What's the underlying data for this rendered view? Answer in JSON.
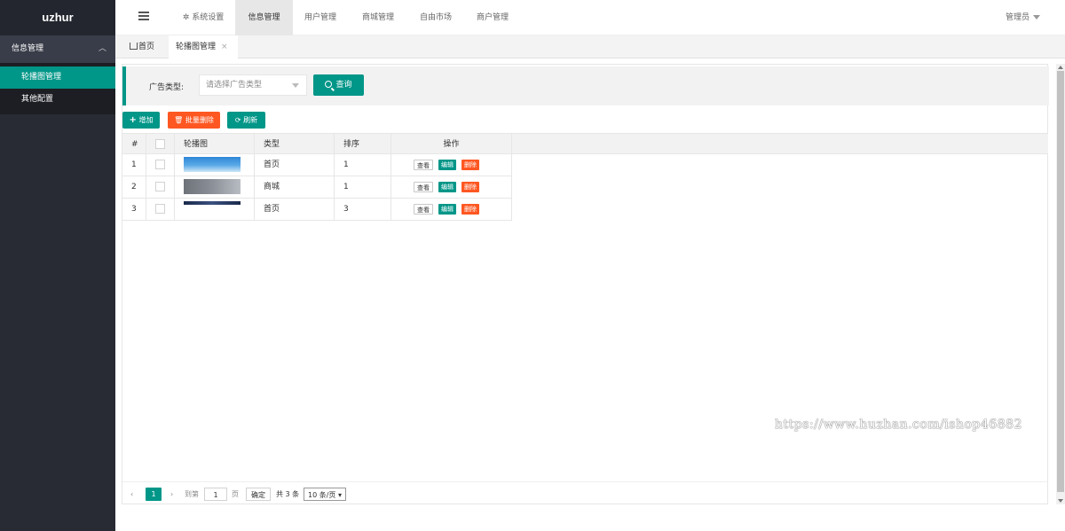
{
  "sidebar": {
    "logo": "uzhur",
    "section": "信息管理",
    "items": [
      "轮播图管理",
      "其他配置"
    ]
  },
  "header": {
    "nav": [
      "系统设置",
      "信息管理",
      "用户管理",
      "商城管理",
      "自由市场",
      "商户管理"
    ],
    "active_nav": "信息管理",
    "user": "管理员"
  },
  "tabs": {
    "home": "首页",
    "current": "轮播图管理",
    "close": "×"
  },
  "search": {
    "label": "广告类型:",
    "placeholder": "请选择广告类型",
    "query_label": "查询"
  },
  "toolbar": {
    "add": "增加",
    "batch_delete": "批量删除",
    "refresh": "刷新"
  },
  "table": {
    "columns": [
      "#",
      "",
      "轮播图",
      "类型",
      "排序",
      "操作"
    ],
    "rows": [
      {
        "idx": "1",
        "type": "首页",
        "sort": "1"
      },
      {
        "idx": "2",
        "type": "商城",
        "sort": "1"
      },
      {
        "idx": "3",
        "type": "首页",
        "sort": "3"
      }
    ],
    "actions": {
      "view": "查看",
      "edit": "编辑",
      "delete": "删除"
    }
  },
  "pager": {
    "prev": "‹",
    "current_page": "1",
    "next": "›",
    "goto_label": "到第",
    "goto_value": "1",
    "page_unit": "页",
    "confirm": "确定",
    "total": "共 3 条",
    "page_size": "10 条/页"
  },
  "watermark": "https://www.huzhan.com/ishop46882",
  "colors": {
    "accent": "#009688",
    "danger": "#ff5722",
    "sidebar": "#282b33"
  }
}
